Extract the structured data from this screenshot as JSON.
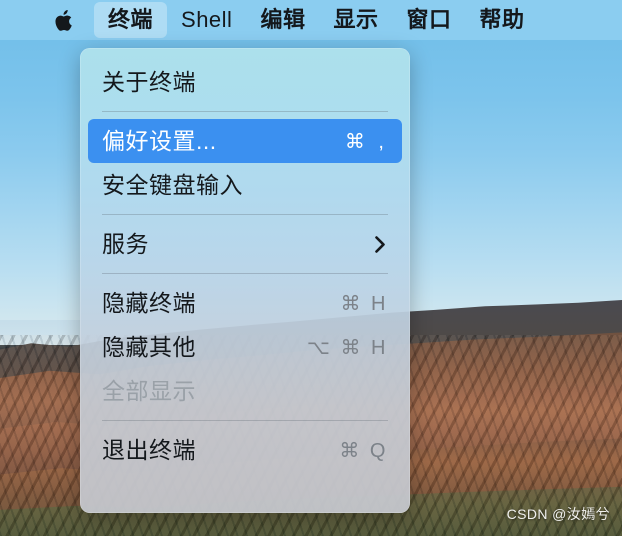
{
  "menubar": {
    "apple_icon": "apple-logo-icon",
    "items": [
      {
        "label": "终端",
        "active": true,
        "cjk": true
      },
      {
        "label": "Shell",
        "active": false,
        "cjk": false
      },
      {
        "label": "编辑",
        "active": false,
        "cjk": true
      },
      {
        "label": "显示",
        "active": false,
        "cjk": true
      },
      {
        "label": "窗口",
        "active": false,
        "cjk": true
      },
      {
        "label": "帮助",
        "active": false,
        "cjk": true
      }
    ]
  },
  "menu": {
    "owner": "终端",
    "items": [
      {
        "kind": "item",
        "label": "关于终端",
        "shortcut": "",
        "state": "normal",
        "name": "menu-item-about-terminal"
      },
      {
        "kind": "separator"
      },
      {
        "kind": "item",
        "label": "偏好设置...",
        "shortcut": "⌘ ,",
        "state": "selected",
        "name": "menu-item-preferences"
      },
      {
        "kind": "item",
        "label": "安全键盘输入",
        "shortcut": "",
        "state": "normal",
        "name": "menu-item-secure-keyboard-entry"
      },
      {
        "kind": "separator"
      },
      {
        "kind": "submenu",
        "label": "服务",
        "shortcut": "",
        "state": "normal",
        "name": "menu-item-services"
      },
      {
        "kind": "separator"
      },
      {
        "kind": "item",
        "label": "隐藏终端",
        "shortcut": "⌘ H",
        "state": "normal",
        "name": "menu-item-hide-terminal"
      },
      {
        "kind": "item",
        "label": "隐藏其他",
        "shortcut": "⌥ ⌘ H",
        "state": "normal",
        "name": "menu-item-hide-others"
      },
      {
        "kind": "item",
        "label": "全部显示",
        "shortcut": "",
        "state": "disabled",
        "name": "menu-item-show-all"
      },
      {
        "kind": "separator"
      },
      {
        "kind": "item",
        "label": "退出终端",
        "shortcut": "⌘ Q",
        "state": "normal",
        "name": "menu-item-quit-terminal"
      }
    ]
  },
  "watermark": {
    "text": "CSDN @汝嫣兮"
  },
  "colors": {
    "menubar_bg": "#8dcdf0",
    "selection_blue": "#3b90f0",
    "text_primary": "#14181c",
    "text_disabled": "#9aa1a8",
    "shortcut_grey": "#7c8289"
  }
}
